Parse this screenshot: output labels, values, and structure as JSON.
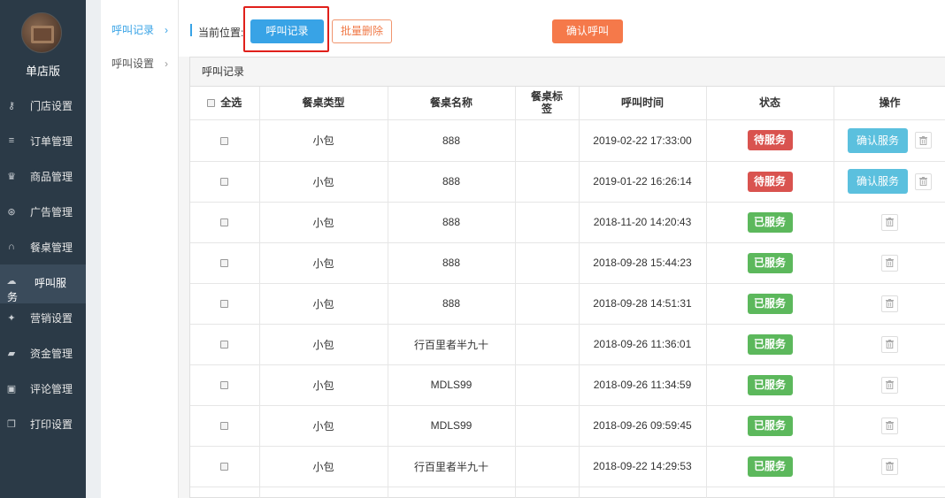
{
  "sidebar": {
    "store_name": "单店版",
    "items": [
      {
        "label": "门店设置",
        "icon": "key-icon"
      },
      {
        "label": "订单管理",
        "icon": "menu-lines-icon"
      },
      {
        "label": "商品管理",
        "icon": "trophy-icon"
      },
      {
        "label": "广告管理",
        "icon": "lifebuoy-icon"
      },
      {
        "label": "餐桌管理",
        "icon": "binoculars-icon"
      },
      {
        "label": "呼叫服",
        "label_wrap": "务",
        "icon": "cloud-icon",
        "active": true
      },
      {
        "label": "营销设置",
        "icon": "gift-icon"
      },
      {
        "label": "资金管理",
        "icon": "book-icon"
      },
      {
        "label": "评论管理",
        "icon": "money-icon"
      },
      {
        "label": "打印设置",
        "icon": "copy-icon"
      }
    ]
  },
  "subnav": {
    "items": [
      {
        "label": "呼叫记录",
        "active": true
      },
      {
        "label": "呼叫设置",
        "active": false
      }
    ],
    "arrow": "›"
  },
  "topbar": {
    "crumb_label": "当前位置:",
    "current_button": "呼叫记录",
    "batch_delete": "批量删除",
    "confirm_call": "确认呼叫"
  },
  "panel": {
    "title": "呼叫记录",
    "columns": [
      "全选",
      "餐桌类型",
      "餐桌名称",
      "餐桌标签",
      "呼叫时间",
      "状态",
      "操作"
    ],
    "rows": [
      {
        "type": "小包",
        "name": "888",
        "tag": "",
        "time": "2019-02-22 17:33:00",
        "status": "待服务",
        "pending": true
      },
      {
        "type": "小包",
        "name": "888",
        "tag": "",
        "time": "2019-01-22 16:26:14",
        "status": "待服务",
        "pending": true
      },
      {
        "type": "小包",
        "name": "888",
        "tag": "",
        "time": "2018-11-20 14:20:43",
        "status": "已服务",
        "pending": false
      },
      {
        "type": "小包",
        "name": "888",
        "tag": "",
        "time": "2018-09-28 15:44:23",
        "status": "已服务",
        "pending": false
      },
      {
        "type": "小包",
        "name": "888",
        "tag": "",
        "time": "2018-09-28 14:51:31",
        "status": "已服务",
        "pending": false
      },
      {
        "type": "小包",
        "name": "行百里者半九十",
        "tag": "",
        "time": "2018-09-26 11:36:01",
        "status": "已服务",
        "pending": false
      },
      {
        "type": "小包",
        "name": "MDLS99",
        "tag": "",
        "time": "2018-09-26 11:34:59",
        "status": "已服务",
        "pending": false
      },
      {
        "type": "小包",
        "name": "MDLS99",
        "tag": "",
        "time": "2018-09-26 09:59:45",
        "status": "已服务",
        "pending": false
      },
      {
        "type": "小包",
        "name": "行百里者半九十",
        "tag": "",
        "time": "2018-09-22 14:29:53",
        "status": "已服务",
        "pending": false
      }
    ],
    "confirm_service": "确认服务"
  }
}
